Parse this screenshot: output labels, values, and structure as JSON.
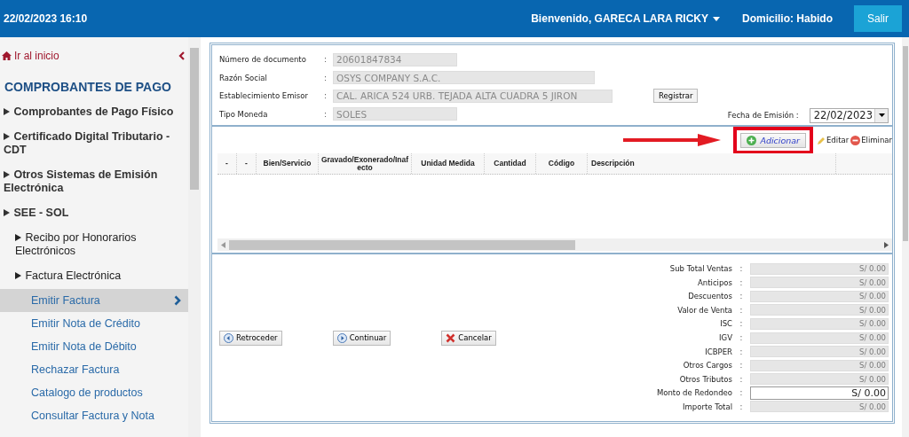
{
  "header": {
    "datetime": "22/02/2023 16:10",
    "welcome": "Bienvenido, GARECA LARA RICKY",
    "domicilio": "Domicilio: Habido",
    "logout": "Salir"
  },
  "sidebar": {
    "home": "Ir al inicio",
    "heading": "COMPROBANTES DE PAGO",
    "items": [
      {
        "label": "Comprobantes de Pago Físico"
      },
      {
        "label": "Certificado Digital Tributario - CDT"
      },
      {
        "label": "Otros Sistemas de Emisión Electrónica"
      },
      {
        "label": "SEE - SOL",
        "children": [
          {
            "label": "Recibo por Honorarios Electrónicos"
          },
          {
            "label": "Factura Electrónica",
            "children": [
              {
                "label": "Emitir Factura",
                "selected": true
              },
              {
                "label": "Emitir Nota de Crédito",
                "selected": false
              },
              {
                "label": "Emitir Nota de Débito",
                "selected": false
              },
              {
                "label": "Rechazar Factura",
                "selected": false
              },
              {
                "label": "Catalogo de productos",
                "selected": false
              },
              {
                "label": "Consultar Factura y Nota",
                "selected": false
              }
            ]
          }
        ]
      }
    ]
  },
  "form": {
    "fields": [
      {
        "label": "Número de documento",
        "colon": ":",
        "value": "20601847834"
      },
      {
        "label": "Razón Social",
        "colon": ":",
        "value": "OSYS COMPANY S.A.C."
      },
      {
        "label": "Establecimiento Emisor",
        "colon": ":",
        "value": "CAL. ARICA 524 URB. TEJADA ALTA CUADRA 5 JIRON",
        "button": "Registrar"
      },
      {
        "label": "Tipo Moneda",
        "colon": ":",
        "value": "SOLES"
      }
    ],
    "date_label": "Fecha de Emisión :",
    "date_value": "22/02/2023"
  },
  "grid": {
    "toolbar": {
      "add": "Adicionar",
      "edit": "Editar",
      "delete": "Eliminar"
    },
    "columns": [
      "-",
      "-",
      "Bien/Servicio",
      "Gravado/Exonerado/Inafecto",
      "Unidad Medida",
      "Cantidad",
      "Código",
      "Descripción"
    ]
  },
  "actions": [
    "Retroceder",
    "Continuar",
    "Cancelar"
  ],
  "totals": [
    {
      "label": "Sub Total Ventas",
      "colon": ":",
      "value": "S/ 0.00",
      "disabled": true
    },
    {
      "label": "Anticipos",
      "colon": ":",
      "value": "S/ 0.00",
      "disabled": true
    },
    {
      "label": "Descuentos",
      "colon": ":",
      "value": "S/ 0.00",
      "disabled": true
    },
    {
      "label": "Valor de Venta",
      "colon": ":",
      "value": "S/ 0.00",
      "disabled": true
    },
    {
      "label": "ISC",
      "colon": ":",
      "value": "S/ 0.00",
      "disabled": true
    },
    {
      "label": "IGV",
      "colon": ":",
      "value": "S/ 0.00",
      "disabled": true
    },
    {
      "label": "ICBPER",
      "colon": ":",
      "value": "S/ 0.00",
      "disabled": true
    },
    {
      "label": "Otros Cargos",
      "colon": ":",
      "value": "S/ 0.00",
      "disabled": true
    },
    {
      "label": "Otros Tributos",
      "colon": ":",
      "value": "S/ 0.00",
      "disabled": true
    },
    {
      "label": "Monto de Redondeo",
      "colon": ":",
      "value": "S/ 0.00",
      "disabled": false
    },
    {
      "label": "Importe Total",
      "colon": ":",
      "value": "S/ 0.00",
      "disabled": true
    }
  ]
}
